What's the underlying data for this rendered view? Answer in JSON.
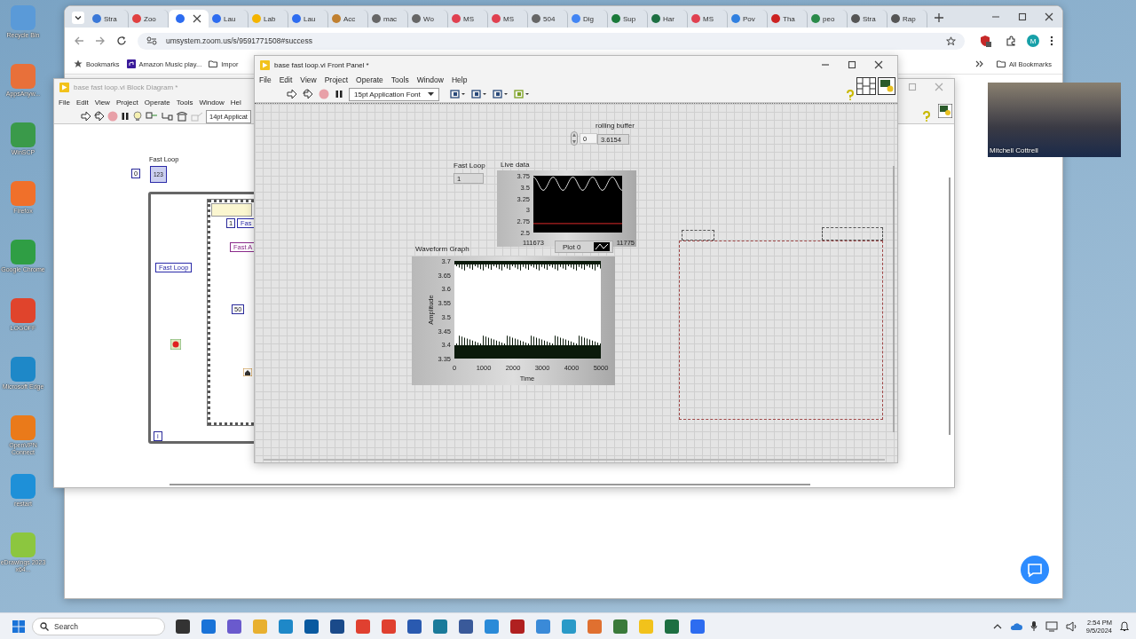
{
  "desktop": {
    "icons": [
      {
        "label": "Recycle Bin",
        "color": "#5a9ad8"
      },
      {
        "label": "AppsAnyw...",
        "color": "#e8703a"
      },
      {
        "label": "WinSCP",
        "color": "#3a9a4a"
      },
      {
        "label": "Firefox",
        "color": "#f0702a"
      },
      {
        "label": "Google Chrome",
        "color": "#2f9e44"
      },
      {
        "label": "LOGOFF",
        "color": "#e0442c"
      },
      {
        "label": "Microsoft Edge",
        "color": "#1e88c8"
      },
      {
        "label": "OpenVPN Connect",
        "color": "#ea7a1a"
      },
      {
        "label": "restart",
        "color": "#1e90d8"
      },
      {
        "label": "eDrawings 2023 x64...",
        "color": "#8cc63f"
      }
    ]
  },
  "browser": {
    "tabs": [
      {
        "label": "Stra",
        "selected": false,
        "color": "#3a78d8"
      },
      {
        "label": "Zoo",
        "selected": false,
        "color": "#e04040"
      },
      {
        "selected": true,
        "color": "#2d6cf0"
      },
      {
        "label": "Lau",
        "selected": false,
        "color": "#2d6cf0"
      },
      {
        "label": "Lab",
        "selected": false,
        "color": "#f4b400"
      },
      {
        "label": "Lau",
        "selected": false,
        "color": "#2d6cf0"
      },
      {
        "label": "Acc",
        "selected": false,
        "color": "#c08030"
      },
      {
        "label": "mac",
        "selected": false,
        "color": "#666666"
      },
      {
        "label": "Wo",
        "selected": false,
        "color": "#666666"
      },
      {
        "label": "MS",
        "selected": false,
        "color": "#e04050"
      },
      {
        "label": "MS",
        "selected": false,
        "color": "#e04050"
      },
      {
        "label": "504",
        "selected": false,
        "color": "#666666"
      },
      {
        "label": "Dig",
        "selected": false,
        "color": "#4285f4"
      },
      {
        "label": "Sup",
        "selected": false,
        "color": "#1a7a3a"
      },
      {
        "label": "Har",
        "selected": false,
        "color": "#1d6f42"
      },
      {
        "label": "MS",
        "selected": false,
        "color": "#e04050"
      },
      {
        "label": "Pov",
        "selected": false,
        "color": "#3080e0"
      },
      {
        "label": "Tha",
        "selected": false,
        "color": "#cc2222"
      },
      {
        "label": "peo",
        "selected": false,
        "color": "#2a8a4a"
      },
      {
        "label": "Stra",
        "selected": false,
        "color": "#555555"
      },
      {
        "label": "Rap",
        "selected": false,
        "color": "#555555"
      }
    ],
    "address": "umsystem.zoom.us/s/9591771508#success",
    "bookmarks": [
      {
        "label": "Bookmarks",
        "kind": "star"
      },
      {
        "label": "Amazon Music play...",
        "kind": "site"
      },
      {
        "label": "Impor",
        "kind": "folder"
      }
    ],
    "all_bookmarks": "All Bookmarks",
    "profile": "M"
  },
  "block_diagram": {
    "title": "base fast loop.vi Block Diagram *",
    "menus": [
      "File",
      "Edit",
      "View",
      "Project",
      "Operate",
      "Tools",
      "Window",
      "Hel"
    ],
    "font": "14pt Applicat",
    "nodes": [
      {
        "kind": "label",
        "text": "Fast Loop"
      },
      {
        "kind": "constant",
        "text": "0"
      },
      {
        "kind": "indicator",
        "text": "123"
      },
      {
        "kind": "constant",
        "text": "1"
      },
      {
        "kind": "local",
        "text": "Fas",
        "color": "#2a2aa8"
      },
      {
        "kind": "local",
        "text": "Fast A",
        "color": "#8a2a8a"
      },
      {
        "kind": "local",
        "text": "Fast Loop",
        "color": "#2a2aa8"
      },
      {
        "kind": "constant",
        "text": "50"
      },
      {
        "kind": "iteration",
        "text": "i"
      }
    ]
  },
  "front_panel": {
    "title": "base fast loop.vi Front Panel *",
    "menus": [
      "File",
      "Edit",
      "View",
      "Project",
      "Operate",
      "Tools",
      "Window",
      "Help"
    ],
    "font": "15pt Application Font",
    "rolling_buffer": {
      "label": "rolling buffer",
      "index": "0",
      "value": "3.6154"
    },
    "fast_loop": {
      "label": "Fast Loop",
      "value": "1"
    },
    "live_data": {
      "label": "Live data",
      "yticks": [
        "3.75",
        "3.5",
        "3.25",
        "3",
        "2.75",
        "2.5"
      ],
      "xticks": [
        "111673",
        "11775"
      ],
      "legend": "Plot 0"
    },
    "waveform_graph": {
      "label": "Waveform Graph",
      "yticks": [
        "3.7",
        "3.65",
        "3.6",
        "3.55",
        "3.5",
        "3.45",
        "3.4",
        "3.35"
      ],
      "xticks": [
        "0",
        "1000",
        "2000",
        "3000",
        "4000",
        "5000"
      ],
      "xlabel": "Time",
      "ylabel": "Amplitude"
    }
  },
  "video": {
    "name": "Mitchell Cottrell"
  },
  "taskbar": {
    "search": {
      "placeholder": "Search"
    },
    "time": "2:54 PM",
    "date": "9/5/2024"
  }
}
